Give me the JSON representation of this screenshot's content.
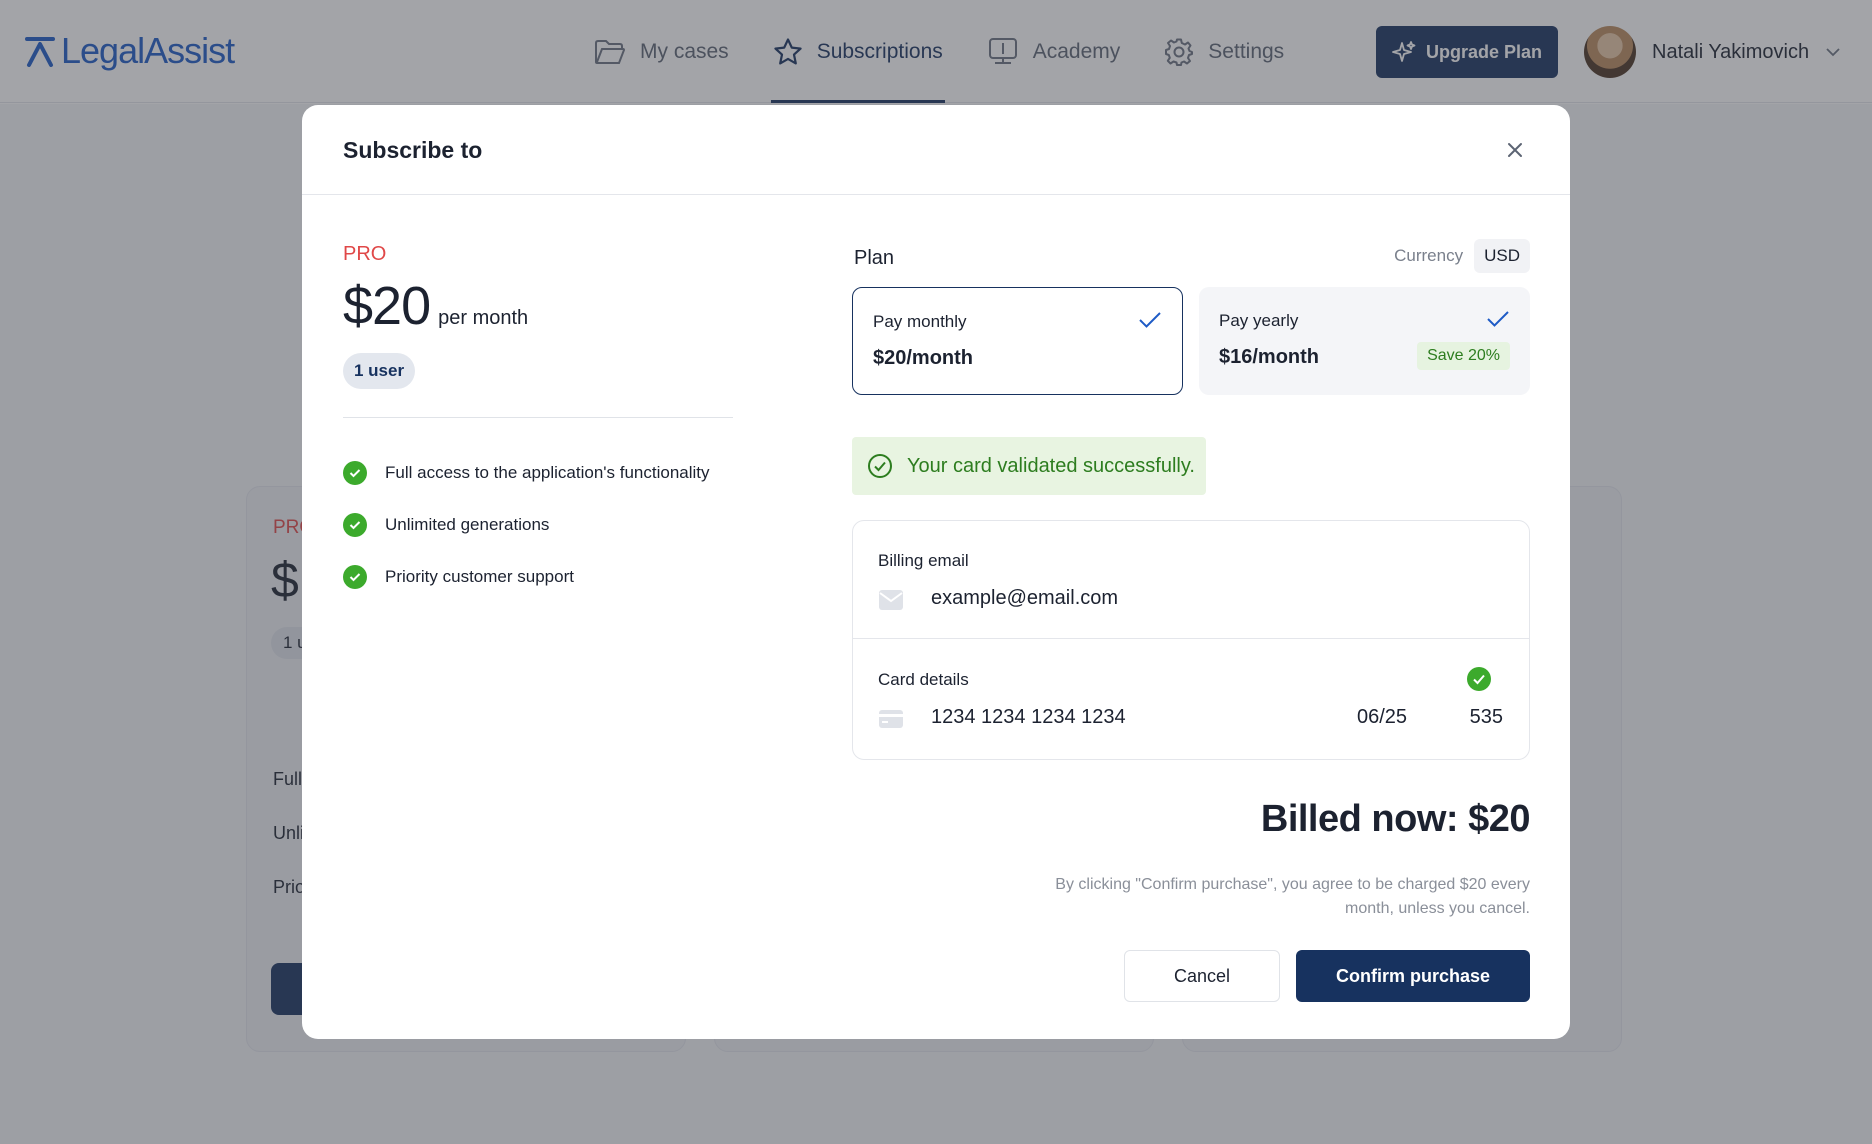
{
  "header": {
    "logo_text": "LegalAssist",
    "nav": [
      {
        "label": "My cases",
        "icon": "folder-icon"
      },
      {
        "label": "Subscriptions",
        "icon": "star-icon",
        "active": true
      },
      {
        "label": "Academy",
        "icon": "academy-icon"
      },
      {
        "label": "Settings",
        "icon": "gear-icon"
      }
    ],
    "upgrade_label": "Upgrade Plan",
    "user_name": "Natali Yakimovich"
  },
  "background_cards": [
    {
      "plan": "PRO",
      "price": "$",
      "badge": "1 u",
      "features": [
        "Full",
        "Unli",
        "Prio"
      ]
    }
  ],
  "modal": {
    "title": "Subscribe to",
    "plan": {
      "name": "PRO",
      "price": "$20",
      "period": "per month",
      "users_badge": "1 user",
      "features": [
        "Full access to the application's functionality",
        "Unlimited generations",
        "Priority customer support"
      ]
    },
    "plan_label": "Plan",
    "currency_label": "Currency",
    "currency_value": "USD",
    "options": [
      {
        "title": "Pay monthly",
        "price": "$20/month",
        "selected": true
      },
      {
        "title": "Pay yearly",
        "price": "$16/month",
        "badge": "Save 20%",
        "selected": false
      }
    ],
    "success_message": "Your card validated successfully.",
    "billing": {
      "email_label": "Billing email",
      "email_value": "example@email.com",
      "card_label": "Card details",
      "card_number": "1234 1234 1234 1234",
      "card_expiry": "06/25",
      "card_cvc": "535"
    },
    "billed_now": "Billed now: $20",
    "disclaimer": "By clicking \"Confirm purchase\", you agree to be charged $20 every month, unless you cancel.",
    "cancel_label": "Cancel",
    "confirm_label": "Confirm purchase"
  },
  "colors": {
    "brand_navy": "#17325f",
    "logo_blue": "#1e5bc6",
    "plan_red": "#e04848",
    "success_green": "#3caa2c"
  }
}
